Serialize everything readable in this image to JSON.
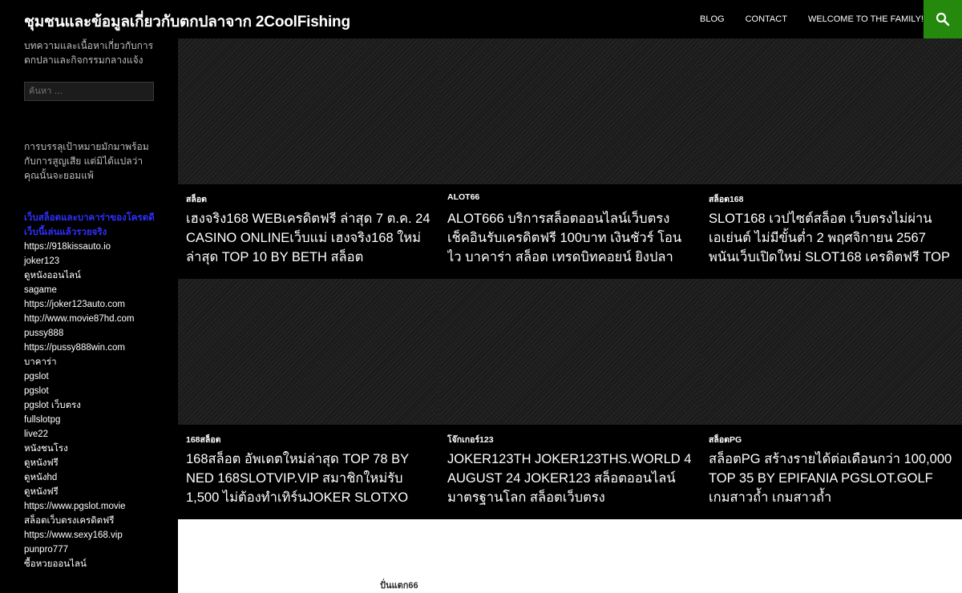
{
  "header": {
    "site_title": "ชุมชนและข้อมูลเกี่ยวกับตกปลาจาก 2CoolFishing",
    "nav": [
      "BLOG",
      "CONTACT",
      "WELCOME TO THE FAMILY!"
    ],
    "search_icon": "search-icon",
    "accent_color": "#24890d"
  },
  "sidebar": {
    "description": "บทความและเนื้อหาเกี่ยวกับการตกปลาและกิจกรรมกลางแจ้ง",
    "search_placeholder": "ค้นหา …",
    "text": "การบรรลุเป้าหมายมักมาพร้อมกับการสูญเสีย แต่มิได้แปลว่าคุณนั้นจะยอมแพ้",
    "links_heading": "เว็บสล็อตและบาคาร่าของโครตดีเว็บนี้เล่นแล้วรวยจริง",
    "links": [
      "https://918kissauto.io",
      "joker123",
      "ดูหนังออนไลน์",
      "sagame",
      "https://joker123auto.com",
      "http://www.movie87hd.com",
      "pussy888",
      "https://pussy888win.com",
      "บาคาร่า",
      "pgslot",
      "pgslot",
      "pgslot เว็บตรง",
      "fullslotpg",
      "live22",
      "หนังชนโรง",
      "ดูหนังฟรี",
      "ดูหนังhd",
      "ดูหนังฟรี",
      "https://www.pgslot.movie",
      "สล็อตเว็บตรงเครดิตฟรี",
      "https://www.sexy168.vip",
      "punpro777",
      "ซื้อหวยออนไลน์"
    ]
  },
  "featured": [
    {
      "category": "สล็อต",
      "title": "เฮงจริง168 WEBเครดิตฟรี ล่าสุด 7 ต.ค. 24 CASINO ONLINEเว็บแม่ เฮงจริง168 ใหม่ล่าสุด TOP 10 BY BETH สล็อต"
    },
    {
      "category": "ALOT66",
      "title": "ALOT666 บริการสล็อตออนไลน์เว็บตรง เช็คอินรับเครดิตฟรี 100บาท เงินชัวร์ โอนไว บาคาร่า สล็อต เทรดบิทคอยน์ ยิงปลา"
    },
    {
      "category": "สล็อต168",
      "title": "SLOT168 เวปไซต์สล็อต เว็บตรงไม่ผ่านเอเย่นต์ ไม่มีขั้นต่ำ 2 พฤศจิกายน 2567 พนันเว็บเปิดใหม่ SLOT168 เครดิตฟรี TOP"
    },
    {
      "category": "168สล็อต",
      "title": "168สล็อต อัพเดตใหม่ล่าสุด TOP 78 BY NED 168SLOTVIP.VIP สมาชิกใหม่รับ 1,500 ไม่ต้องทำเทิร์นJOKER SLOTXO"
    },
    {
      "category": "โจ๊กเกอร์123",
      "title": "JOKER123TH JOKER123THS.WORLD 4 AUGUST 24 JOKER123 สล็อตออนไลน์มาตรฐานโลก สล็อตเว็บตรง"
    },
    {
      "category": "สล็อตPG",
      "title": "สล็อตPG สร้างรายได้ต่อเดือนกว่า 100,000 TOP 35 BY EPIFANIA PGSLOT.GOLF เกมสาวถ้ำ เกมสาวถ้ำ"
    }
  ],
  "content": {
    "category_label": "ปั่นแตก66"
  }
}
